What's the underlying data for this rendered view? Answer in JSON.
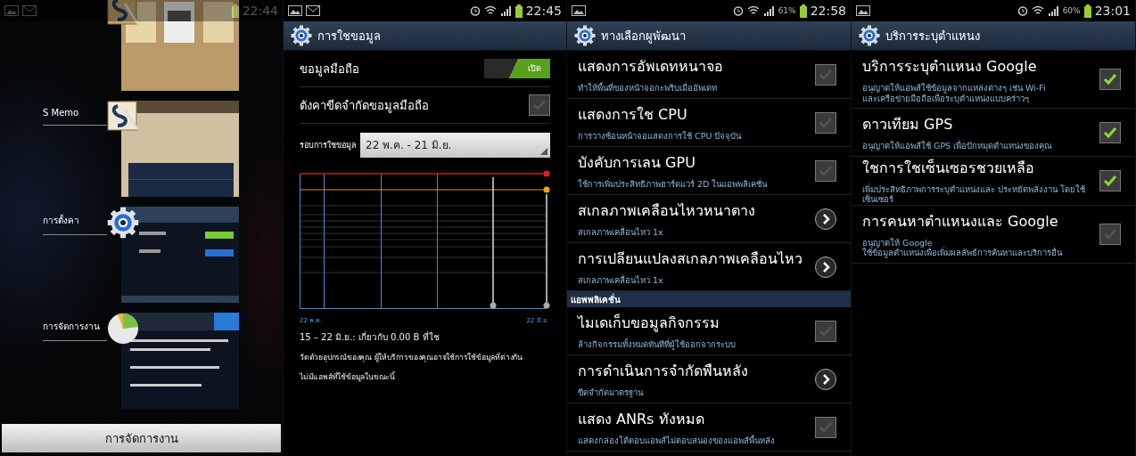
{
  "screens": [
    {
      "kind": "recents",
      "status_bar": {
        "time": "22:44"
      },
      "apps": [
        {
          "kind": "books"
        },
        {
          "kind": "memo",
          "name": "S Memo"
        },
        {
          "kind": "settings",
          "name": "การตั้งคา"
        },
        {
          "kind": "tasks",
          "name": "การจัดการงาน"
        }
      ],
      "button": "การจัดการงาน"
    },
    {
      "kind": "data_usage",
      "status_bar": {
        "time": "22:45"
      },
      "title": "การใชขอมูล",
      "mobile_data": {
        "label": "ขอมูลมือถือ",
        "on": true,
        "state_text": "เปิด"
      },
      "limit": {
        "label": "ตังคาขีดจำกัดขอมูลมือถือ",
        "checked": false
      },
      "cycle": {
        "label": "รอบการใชขอมูล",
        "value": "22 พ.ค. - 21 มิ.ย."
      },
      "chart": {
        "start_label": "22 พ.ค.",
        "end_label": "22 มิ.ย."
      },
      "summary": "15 – 22 มิ.ย.: เกี่ยวกับ 0.00 B ที่ใช",
      "note": "วัดด้วยอุปกรณ์ของคุณ ผู้ให้บริการของคุณอาจใช้การใช้ข้อมูลที่ต่างกัน",
      "empty": "ไม่มีแอพส์ที่ใช้ข้อมูลในขณะนี้"
    },
    {
      "kind": "list",
      "status_bar": {
        "time": "22:58",
        "battery": "61%"
      },
      "title": "ทางเลือกผูพัฒนา",
      "items": [
        {
          "kind": "checkbox",
          "title": "แสดงการอัพเดทหนาจอ",
          "subtitle": "ทำให้พื้นที่ของหน้าจอกะพริบเมื่ออัพเดท",
          "checked": false
        },
        {
          "kind": "checkbox",
          "title": "แสดงการใช CPU",
          "subtitle": "การวางซ้อนหน้าจอแสดงการใช้ CPU ปัจจุบัน",
          "checked": false
        },
        {
          "kind": "checkbox",
          "title": "บังคับการเลน GPU",
          "subtitle": "ใช้การเพิ่มประสิทธิภาพฮาร์ดแวร์ 2D ในแอพพลิเคชั่น",
          "checked": false
        },
        {
          "kind": "arrow",
          "title": "สเกลภาพเคลือนไหวหนาตาง",
          "subtitle": "สเกลภาพเคลื่อนไหว 1x"
        },
        {
          "kind": "arrow",
          "title": "การเปลียนแปลงสเกลภาพเคลือนไหว",
          "subtitle": "สเกลภาพเคลื่อนไหว 1x"
        },
        {
          "kind": "header",
          "title": "แอพพลิเคชั่น"
        },
        {
          "kind": "checkbox",
          "title": "ไมเดเก็บขอมูลกิจกรรม",
          "subtitle": "ล้างกิจกรรมทั้งหมดทันทีที่ผู้ใช้ออกจากระบบ",
          "checked": false
        },
        {
          "kind": "arrow",
          "title": "การดำเนินการจำกัดพืนหลัง",
          "subtitle": "ขีดจำกัดมาตรฐาน"
        },
        {
          "kind": "checkbox",
          "title": "แสดง ANRs ทังหมด",
          "subtitle": "แสดงกล่องโต้ตอบแอพส์ไม่ตอบสนองของแอพส์พื้นหลัง",
          "checked": false
        }
      ]
    },
    {
      "kind": "list",
      "status_bar": {
        "time": "23:01",
        "battery": "60%"
      },
      "title": "บริการระบุตำแหนง",
      "items": [
        {
          "kind": "checkbox",
          "title": "บริการระบุตำแหนง Google",
          "subtitle": "อนุญาตให้แอพส์ใช้ข้อมูลจากแหล่งต่างๆ เช่น Wi-Fi\nและเครือข่ายมือถือเพื่อระบุตำแหน่งแบบคร่าวๆ",
          "checked": true
        },
        {
          "kind": "checkbox",
          "title": "ดาวเทียม GPS",
          "subtitle": "อนุญาตให้แอพส์ใช้ GPS เพื่อปักหมุดตำแหน่งของคุณ",
          "checked": true
        },
        {
          "kind": "checkbox",
          "title": "ใชการใชเซ็นเซอรชวยเหลือ",
          "subtitle": "เพิ่มประสิทธิภาพการระบุตำแหน่งและ ประหยัดพลังงาน โดยใช้เซ็นเซอร์",
          "checked": true
        },
        {
          "kind": "checkbox",
          "title": "การคนหาตำแหนงและ Google",
          "subtitle": "อนุญาตให้ Google\nใช้ข้อมูลตำแหน่งเพื่อเพิ่มผลลัพธ์การค้นหาและบริการอื่น",
          "checked": false
        }
      ]
    }
  ]
}
